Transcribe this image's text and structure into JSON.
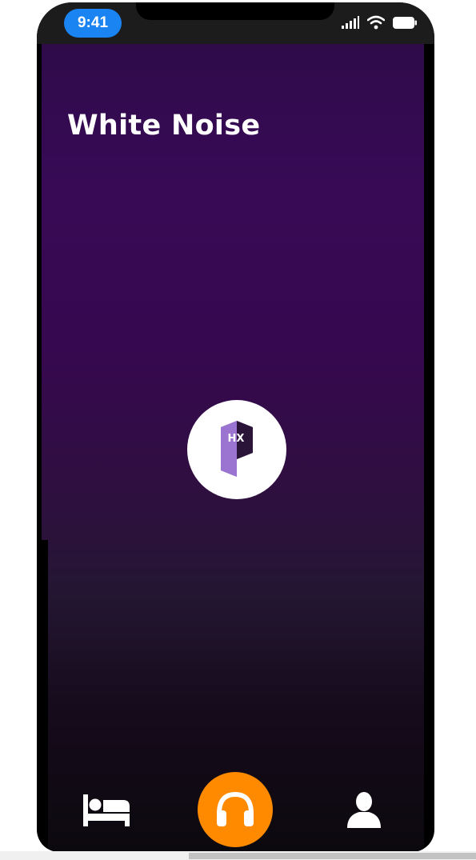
{
  "status_bar": {
    "time": "9:41",
    "icons": [
      "cellular-signal-icon",
      "wifi-icon",
      "battery-icon"
    ],
    "time_pill_color": "#1a84f2"
  },
  "page": {
    "title": "White Noise"
  },
  "logo": {
    "text": "HX",
    "icon": "hx-p-logo-icon"
  },
  "bottom_nav": {
    "items": [
      {
        "icon": "bed-icon",
        "active": false
      },
      {
        "icon": "headphones-icon",
        "active": true,
        "accent": "#ff8a00"
      },
      {
        "icon": "user-icon",
        "active": false
      }
    ]
  },
  "colors": {
    "background_top": "#380a56",
    "background_bottom": "#0c090e",
    "accent": "#ff8a00"
  }
}
